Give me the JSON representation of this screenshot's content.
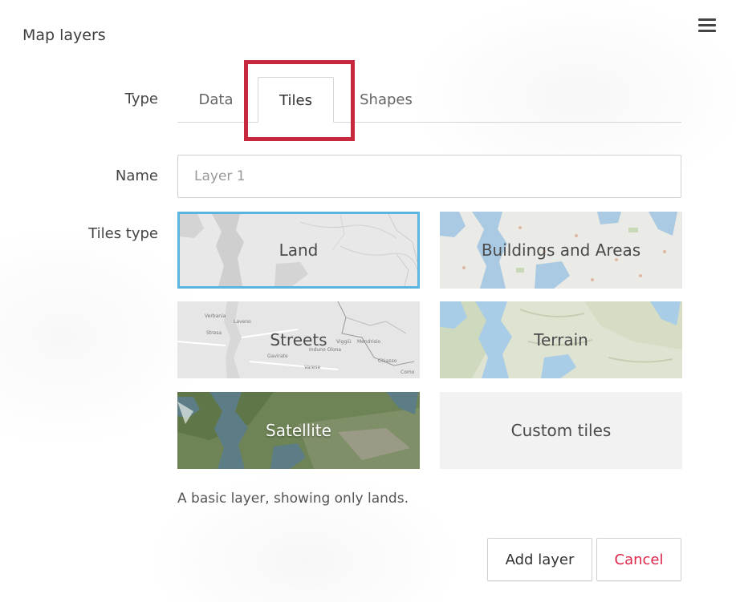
{
  "panel": {
    "title": "Map layers"
  },
  "labels": {
    "type": "Type",
    "name": "Name",
    "tiles_type": "Tiles type"
  },
  "tabs": [
    {
      "label": "Data",
      "active": false
    },
    {
      "label": "Tiles",
      "active": true
    },
    {
      "label": "Shapes",
      "active": false
    }
  ],
  "name_field": {
    "value": "",
    "placeholder": "Layer 1"
  },
  "tiles": [
    {
      "label": "Land",
      "selected": true
    },
    {
      "label": "Buildings and Areas",
      "selected": false
    },
    {
      "label": "Streets",
      "selected": false
    },
    {
      "label": "Terrain",
      "selected": false
    },
    {
      "label": "Satellite",
      "selected": false
    },
    {
      "label": "Custom tiles",
      "selected": false
    }
  ],
  "street_map_places": [
    "Verbania",
    "Laveno",
    "Stresa",
    "Mendrisio",
    "Gavirate",
    "Induno Olona",
    "Chiasso",
    "Varese",
    "Como",
    "Viggiù"
  ],
  "description": "A basic layer, showing only lands.",
  "buttons": {
    "add_layer": "Add layer",
    "cancel": "Cancel"
  },
  "colors": {
    "selected_border": "#5ab4e0",
    "highlight_box": "#c8283e",
    "cancel_text": "#e0254a",
    "water": "#a9cde6"
  },
  "icons": {
    "menu": "hamburger-menu-icon"
  }
}
